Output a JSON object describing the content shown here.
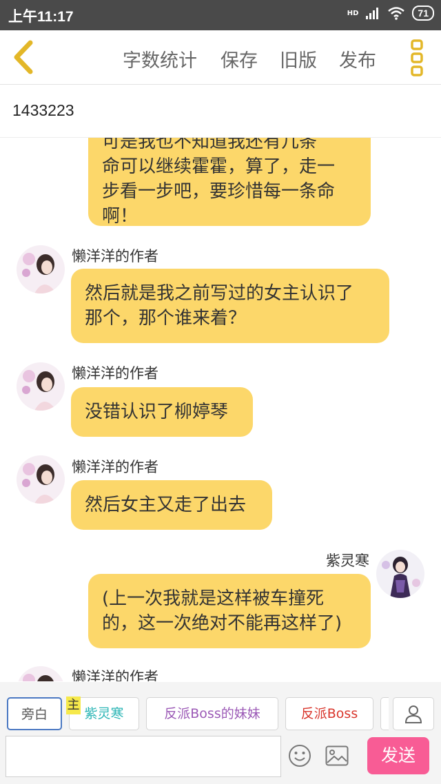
{
  "status_bar": {
    "time": "上午11:17",
    "network": "HD",
    "battery": "71"
  },
  "toolbar": {
    "actions": [
      "字数统计",
      "保存",
      "旧版",
      "发布"
    ]
  },
  "story_title": "1433223",
  "messages": [
    {
      "side": "right",
      "text_lines": [
        "可是我也不知道我还有几条",
        "命可以继续霍霍，算了，走一",
        "步看一步吧，要珍惜每一条命",
        "啊！"
      ]
    },
    {
      "side": "left",
      "sender": "懒洋洋的作者",
      "text_lines": [
        "然后就是我之前写过的女主认识了",
        "那个，那个谁来着？"
      ]
    },
    {
      "side": "left",
      "sender": "懒洋洋的作者",
      "text_lines": [
        "没错认识了柳婷琴"
      ]
    },
    {
      "side": "left",
      "sender": "懒洋洋的作者",
      "text_lines": [
        "然后女主又走了出去"
      ]
    },
    {
      "side": "right",
      "sender": "紫灵寒",
      "text_lines": [
        "(上一次我就是这样被车撞死",
        "的，这一次绝对不能再这样了)"
      ]
    },
    {
      "side": "left",
      "sender": "懒洋洋的作者",
      "text_lines": []
    }
  ],
  "roles": {
    "narration": "旁白",
    "main_tag": "主",
    "chips": [
      "紫灵寒",
      "反派Boss的妹妹",
      "反派Boss"
    ]
  },
  "input": {
    "value": "",
    "placeholder": ""
  },
  "send_label": "发送",
  "colors": {
    "bubble": "#fcd76a",
    "accent_yellow": "#e3b728",
    "send": "#f85c95",
    "chip_teal": "#2bb5b5",
    "chip_purple": "#9b59b6",
    "chip_red": "#d9352b",
    "narration_border": "#4a78c2"
  }
}
